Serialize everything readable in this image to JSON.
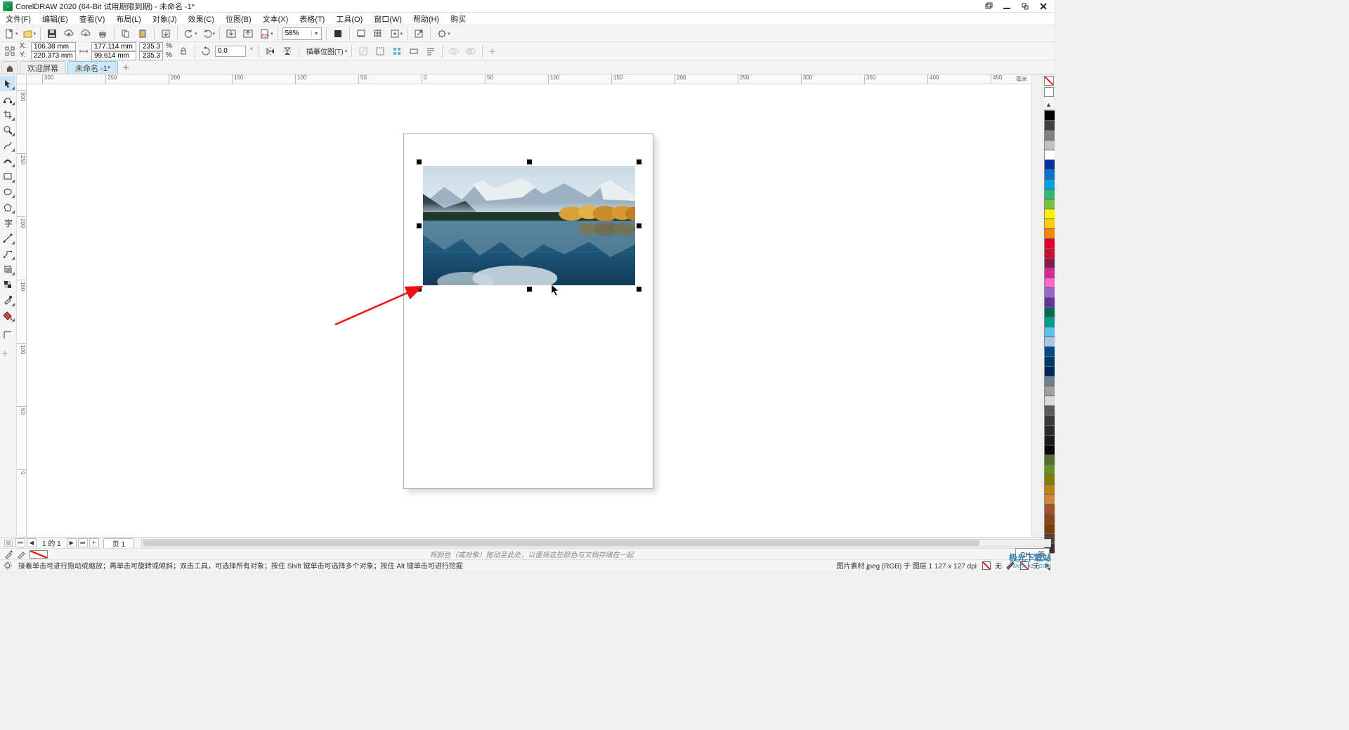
{
  "titlebar": {
    "title": "CorelDRAW 2020 (64-Bit 试用期限到期) - 未命名 -1*"
  },
  "menu": {
    "items": [
      "文件(F)",
      "编辑(E)",
      "查看(V)",
      "布局(L)",
      "对象(J)",
      "效果(C)",
      "位图(B)",
      "文本(X)",
      "表格(T)",
      "工具(O)",
      "窗口(W)",
      "帮助(H)",
      "购买"
    ]
  },
  "toolbar1": {
    "zoom": "58%"
  },
  "propbar": {
    "x": "106.38 mm",
    "y": "220.373 mm",
    "w": "177.114 mm",
    "h": "99.614 mm",
    "sx": "235.3",
    "sy": "235.3",
    "rot": "0.0",
    "trace": "描摹位图(T)"
  },
  "doctabs": {
    "home": "⌂",
    "welcome": "欢迎屏幕",
    "doc": "未命名 -1*"
  },
  "ruler": {
    "unit": "毫米",
    "h_ticks": [
      "300",
      "250",
      "200",
      "150",
      "100",
      "50",
      "0",
      "50",
      "100",
      "150",
      "200",
      "250",
      "300",
      "350",
      "400",
      "450"
    ],
    "v_ticks": [
      "300",
      "250",
      "200",
      "150",
      "100",
      "50",
      "0"
    ]
  },
  "pagenav": {
    "count": "1 的 1",
    "page": "页 1"
  },
  "colorbar": {
    "hint": "将颜色（或对象）拖动至此处，以便将这些颜色与文档存储在一起",
    "ime": "CH ♪ 简"
  },
  "status": {
    "msg": "接着单击可进行拖动或缩放；再单击可旋转或倾斜；双击工具，可选择所有对象；按住 Shift 键单击可选择多个对象；按住 Alt 键单击可进行挖掘",
    "obj": "图片素材.jpeg (RGB) 于 图层 1  127 x 127 dpi",
    "fill_none": "无",
    "stroke_none": "无"
  },
  "watermark": {
    "brand": "极光下载站",
    "url": "www.xz7.com"
  },
  "palette_colors": [
    "#000000",
    "#404040",
    "#808080",
    "#c0c0c0",
    "#ffffff",
    "#0033a0",
    "#0072ce",
    "#00a3e0",
    "#2eb872",
    "#7ac143",
    "#fff200",
    "#ffcd00",
    "#ff8300",
    "#e4002b",
    "#c8102e",
    "#8b1a4b",
    "#d42b8e",
    "#ff66cc",
    "#9966cc",
    "#663399",
    "#006b54",
    "#009e8f",
    "#5bc2e7",
    "#a7c7e7",
    "#004b87",
    "#003865",
    "#002855",
    "#708090",
    "#a0a0a0",
    "#d9d9d9",
    "#5a5a5a",
    "#3a3a3a",
    "#2a2a2a",
    "#1a1a1a",
    "#0a0a0a",
    "#556b2f",
    "#6b8e23",
    "#808000",
    "#b8860b",
    "#cd853f",
    "#a0522d",
    "#8b4513",
    "#7b3f00",
    "#5c4033",
    "#3b2f2f"
  ]
}
